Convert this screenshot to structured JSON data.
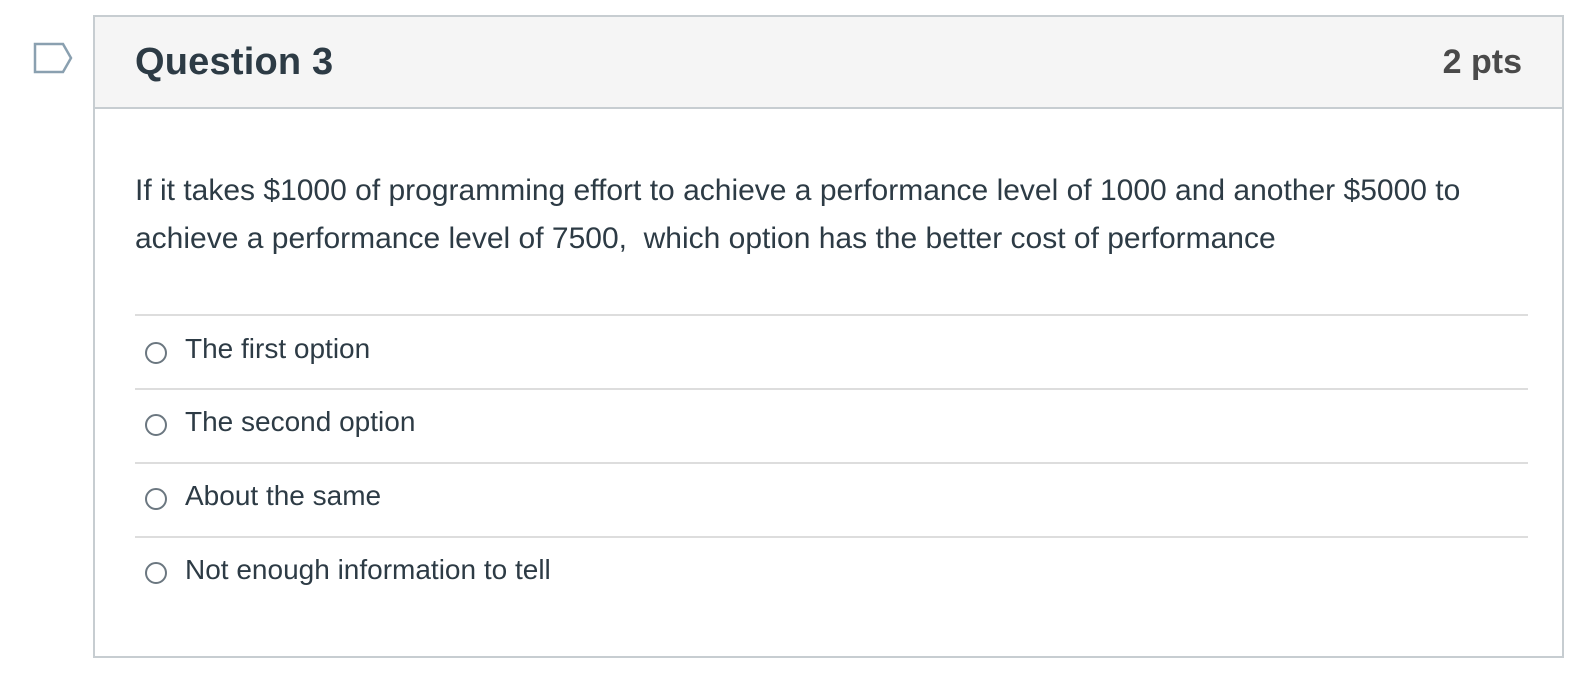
{
  "question": {
    "title": "Question 3",
    "points": "2 pts",
    "text": "If it takes $1000 of programming effort to achieve a performance level of 1000 and another $5000 to achieve a performance level of 7500,  which option has the better cost of performance",
    "flag_icon": "bookmark-flag-icon"
  },
  "answers": [
    {
      "label": "The first option",
      "selected": false
    },
    {
      "label": "The second option",
      "selected": false
    },
    {
      "label": "About the same",
      "selected": false
    },
    {
      "label": "Not enough information to tell",
      "selected": false
    }
  ],
  "colors": {
    "header_bg": "#f5f5f5",
    "border": "#c7cdd1",
    "text": "#2d3b45",
    "flag_stroke": "#8aa0b0"
  }
}
